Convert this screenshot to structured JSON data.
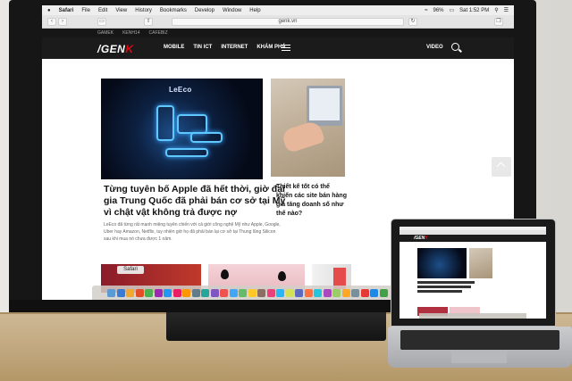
{
  "menubar": {
    "apple": "",
    "items": [
      "Safari",
      "File",
      "Edit",
      "View",
      "History",
      "Bookmarks",
      "Develop",
      "Window",
      "Help"
    ],
    "battery": "96%",
    "clock": "Sat 1:52 PM"
  },
  "browser": {
    "url": "genk.vn"
  },
  "site": {
    "top_links": [
      "GAMEK",
      "KENH14",
      "CAFEBIZ"
    ],
    "logo_prefix": "/GEN",
    "logo_suffix": "K",
    "nav": [
      "MOBILE",
      "TIN ICT",
      "INTERNET",
      "KHÁM PHÁ"
    ],
    "video": "VIDEO"
  },
  "hero": {
    "brand": "LeEco",
    "title": "Từng tuyên bố Apple đã hết thời, giờ đại gia Trung Quốc đã phải bán cơ sở tại Mỹ vì chật vật không trả được nợ",
    "description": "LeEco đã từng rất mạnh miệng tuyên chiến với cả giới công nghệ Mỹ như Apple, Google, Uber hay Amazon, Netflix, tuy nhiên giờ họ đã phải bán lại cơ sở tại Thung lũng Silicon sau khi mua nó chưa được 1 năm."
  },
  "side_article": {
    "title": "Thiết kế tốt có thể khiến các site bán hàng gia tăng doanh số như thế nào?"
  },
  "tooltip": "Safari",
  "dock_colors": [
    "#5b9bd5",
    "#3a7bd5",
    "#f0a830",
    "#e44d26",
    "#4caf50",
    "#9c27b0",
    "#2196f3",
    "#e91e63",
    "#ff9800",
    "#607d8b",
    "#26a69a",
    "#7e57c2",
    "#ef5350",
    "#42a5f5",
    "#66bb6a",
    "#ffca28",
    "#8d6e63",
    "#ec407a",
    "#29b6f6",
    "#d4e157",
    "#5c6bc0",
    "#ff7043",
    "#26c6da",
    "#ab47bc",
    "#9ccc65",
    "#ffa726",
    "#78909c",
    "#e53935",
    "#1e88e5",
    "#43a047"
  ]
}
